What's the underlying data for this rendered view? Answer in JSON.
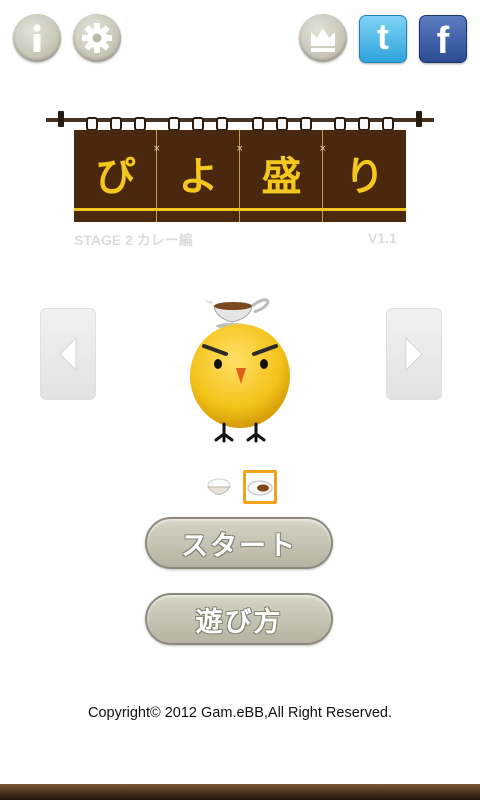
{
  "toolbar": {
    "info_icon": "info-icon",
    "settings_icon": "gear-icon",
    "ranking_icon": "crown-icon",
    "twitter_glyph": "t",
    "facebook_glyph": "f"
  },
  "banner": {
    "chars": [
      "ぴ",
      "よ",
      "盛",
      "り"
    ],
    "stage_label": "STAGE 2  カレー編",
    "version": "V1.1"
  },
  "character": {
    "prev_icon": "arrow-left-icon",
    "next_icon": "arrow-right-icon"
  },
  "dishes": {
    "items": [
      "rice-bowl-icon",
      "curry-plate-icon"
    ],
    "selected": "curry-plate-icon"
  },
  "buttons": {
    "start_label": "スタート",
    "howto_label": "遊び方"
  },
  "footer": {
    "copyright": "Copyright© 2012 Gam.eBB,All Right Reserved."
  },
  "colors": {
    "banner_bg": "#4a280d",
    "title_yellow": "#f3c71d",
    "button_gray": "#c8c4b4",
    "selected_border": "#f2a21b",
    "twitter": "#2ea3dc",
    "facebook": "#2d4c92"
  }
}
